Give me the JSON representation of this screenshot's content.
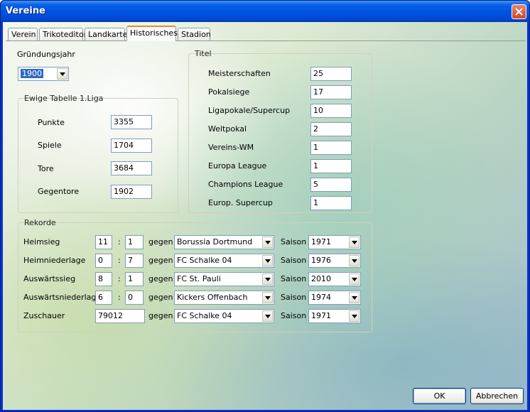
{
  "window": {
    "title": "Vereine"
  },
  "tabs": [
    "Verein",
    "Trikoteditor",
    "Landkarte",
    "Historisches",
    "Stadion"
  ],
  "founding": {
    "label": "Gründungsjahr",
    "value": "1900"
  },
  "eternal": {
    "legend": "Ewige Tabelle 1.Liga",
    "rows": [
      {
        "label": "Punkte",
        "value": "3355"
      },
      {
        "label": "Spiele",
        "value": "1704"
      },
      {
        "label": "Tore",
        "value": "3684"
      },
      {
        "label": "Gegentore",
        "value": "1902"
      }
    ]
  },
  "titles": {
    "legend": "Titel",
    "rows": [
      {
        "label": "Meisterschaften",
        "value": "25"
      },
      {
        "label": "Pokalsiege",
        "value": "17"
      },
      {
        "label": "Ligapokale/Supercup",
        "value": "10"
      },
      {
        "label": "Weltpokal",
        "value": "2"
      },
      {
        "label": "Vereins-WM",
        "value": "1"
      },
      {
        "label": "Europa League",
        "value": "1"
      },
      {
        "label": "Champions League",
        "value": "5"
      },
      {
        "label": "Europ. Supercup",
        "value": "1"
      }
    ]
  },
  "records": {
    "legend": "Rekorde",
    "gegen": "gegen",
    "saison": "Saison",
    "colon": ":",
    "rows": [
      {
        "label": "Heimsieg",
        "a": "11",
        "b": "1",
        "opponent": "Borussia Dortmund",
        "season": "1971"
      },
      {
        "label": "Heimniederlage",
        "a": "0",
        "b": "7",
        "opponent": "FC Schalke 04",
        "season": "1976"
      },
      {
        "label": "Auswärtssieg",
        "a": "8",
        "b": "1",
        "opponent": "FC St. Pauli",
        "season": "2010"
      },
      {
        "label": "Auswärtsniederlage",
        "a": "6",
        "b": "0",
        "opponent": "Kickers Offenbach",
        "season": "1974"
      }
    ],
    "spectators": {
      "label": "Zuschauer",
      "value": "79012",
      "opponent": "FC Schalke 04",
      "season": "1971"
    }
  },
  "buttons": {
    "ok": "OK",
    "cancel": "Abbrechen"
  }
}
